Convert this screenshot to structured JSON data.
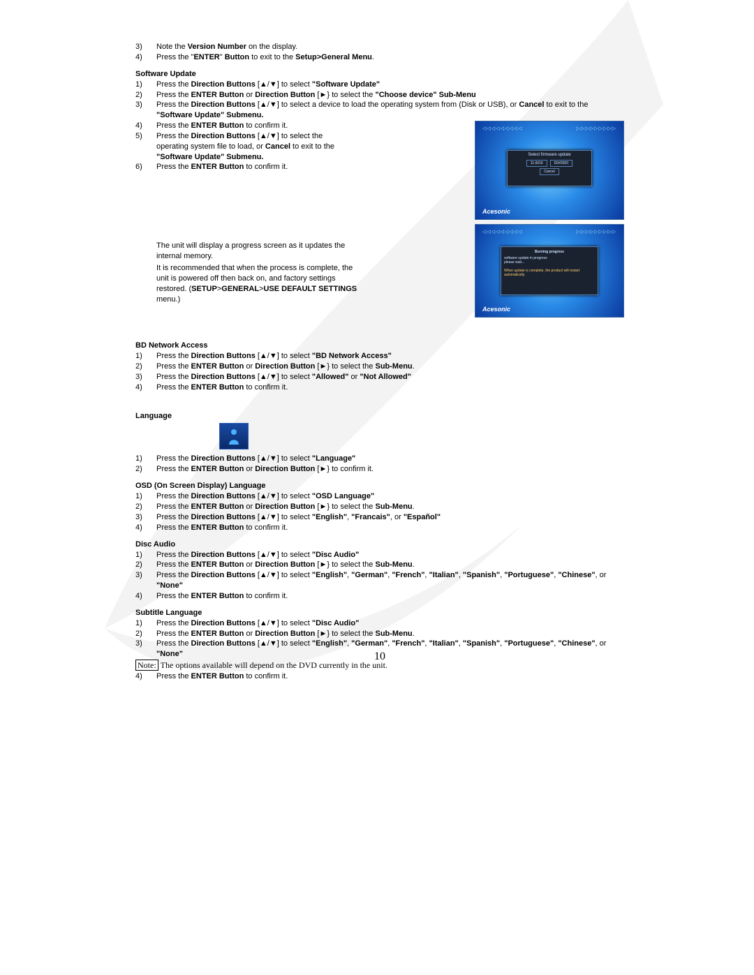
{
  "intro_list": [
    {
      "n": "3)",
      "txt": "Note the <b>Version Number</b> on the display."
    },
    {
      "n": "4)",
      "txt": "Press the \"<b>ENTER</b>\" <b>Button</b> to exit to the <b>Setup>General Menu</b>."
    }
  ],
  "software_update": {
    "heading": "Software Update",
    "items": [
      {
        "n": "1)",
        "txt": "Press the <b>Direction Buttons</b> [▲/▼] to select <b>\"Software Update\"</b>"
      },
      {
        "n": "2)",
        "txt": "Press the <b>ENTER Button</b> or <b>Direction Button</b> [►} to select the <b>\"Choose device\" Sub-Menu</b>"
      },
      {
        "n": "3)",
        "txt": "Press the <b>Direction Buttons</b> [▲/▼] to select a device to load the operating system from (Disk or USB), or <b>Cancel</b> to exit to the <b>\"Software Update\" Submenu.</b>"
      },
      {
        "n": "4)",
        "txt": "Press the <b>ENTER Button</b> to confirm it."
      },
      {
        "n": "5)",
        "txt": "Press the <b>Direction Buttons</b> [▲/▼] to select the operating system file to load, or <b>Cancel</b> to exit to the <b>\"Software Update\" Submenu.</b>"
      },
      {
        "n": "6)",
        "txt": "Press the <b>ENTER Button</b> to confirm it."
      }
    ],
    "para1": "The unit will display a progress screen as it updates the internal memory.",
    "para2": "It is recommended that when the process is complete, the unit is powered off then back on, and factory settings restored. (<b>SETUP</b>><b>GENERAL</b>><b>USE DEFAULT SETTINGS</b> menu.)"
  },
  "screenshot1": {
    "title": "Select firmware update",
    "btn1": "11.6016",
    "btn2": "6D#2600",
    "btn3": "Cancel",
    "logo": "Acesonic"
  },
  "screenshot2": {
    "line1": "Burning progress",
    "line2": "software update in progress",
    "line3": "please wait...",
    "line4": "When update is complete, the product will restart automatically.",
    "logo": "Acesonic"
  },
  "bd_network": {
    "heading": "BD Network Access",
    "items": [
      {
        "n": "1)",
        "txt": "Press the <b>Direction Buttons</b> [▲/▼] to select <b>\"BD Network Access\"</b>"
      },
      {
        "n": "2)",
        "txt": "Press the <b>ENTER Button</b> or <b>Direction Button</b> [►} to select the <b>Sub-Menu</b>."
      },
      {
        "n": "3)",
        "txt": "Press the <b>Direction Buttons</b> [▲/▼] to select <b>\"Allowed\"</b> or <b>\"Not Allowed\"</b>"
      },
      {
        "n": "4)",
        "txt": "Press the <b>ENTER Button</b> to confirm it."
      }
    ]
  },
  "language": {
    "heading": "Language",
    "items": [
      {
        "n": "1)",
        "txt": "Press the <b>Direction Buttons</b> [▲/▼] to select <b>\"Language\"</b>"
      },
      {
        "n": "2)",
        "txt": "Press the <b>ENTER Button</b> or <b>Direction Button</b> [►} to confirm it."
      }
    ]
  },
  "osd_lang": {
    "heading": "OSD (On Screen Display) Language",
    "items": [
      {
        "n": "1)",
        "txt": "Press the <b>Direction Buttons</b> [▲/▼] to select <b>\"OSD Language\"</b>"
      },
      {
        "n": "2)",
        "txt": "Press the <b>ENTER Button</b> or <b>Direction Button</b> [►} to select the <b>Sub-Menu</b>."
      },
      {
        "n": "3)",
        "txt": "Press the <b>Direction Buttons</b> [▲/▼] to select <b>\"English\"</b>, <b>\"Francais\"</b>, or <b>\"Español\"</b>"
      },
      {
        "n": "4)",
        "txt": "Press the <b>ENTER Button</b> to confirm it."
      }
    ]
  },
  "disc_audio": {
    "heading": "Disc Audio",
    "items": [
      {
        "n": "1)",
        "txt": "Press the <b>Direction Buttons</b> [▲/▼] to select <b>\"Disc Audio\"</b>"
      },
      {
        "n": "2)",
        "txt": "Press the <b>ENTER Button</b> or <b>Direction Button</b> [►} to select the <b>Sub-Menu</b>."
      },
      {
        "n": "3)",
        "txt": "Press the <b>Direction Buttons</b> [▲/▼] to select <b>\"English\"</b>, <b>\"German\"</b>, <b>\"French\"</b>, <b>\"Italian\"</b>, <b>\"Spanish\"</b>, <b>\"Portuguese\"</b>, <b>\"Chinese\"</b>, or <b>\"None\"</b>"
      },
      {
        "n": "4)",
        "txt": "Press the <b>ENTER Button</b> to confirm it."
      }
    ]
  },
  "subtitle_lang": {
    "heading": "Subtitle Language",
    "items": [
      {
        "n": "1)",
        "txt": "Press the <b>Direction Buttons</b> [▲/▼] to select <b>\"Disc Audio\"</b>"
      },
      {
        "n": "2)",
        "txt": "Press the <b>ENTER Button</b> or <b>Direction Button</b> [►} to select the <b>Sub-Menu</b>."
      },
      {
        "n": "3)",
        "txt": "Press the <b>Direction Buttons</b> [▲/▼] to select <b>\"English\"</b>, <b>\"German\"</b>, <b>\"French\"</b>, <b>\"Italian\"</b>, <b>\"Spanish\"</b>, <b>\"Portuguese\"</b>, <b>\"Chinese\"</b>, or <b>\"None\"</b>"
      }
    ],
    "note_label": "Note:",
    "note_text": "The options available will depend on the DVD currently in the unit.",
    "final": {
      "n": "4)",
      "txt": "Press the <b>ENTER Button</b> to confirm it."
    }
  },
  "page_number": "10"
}
